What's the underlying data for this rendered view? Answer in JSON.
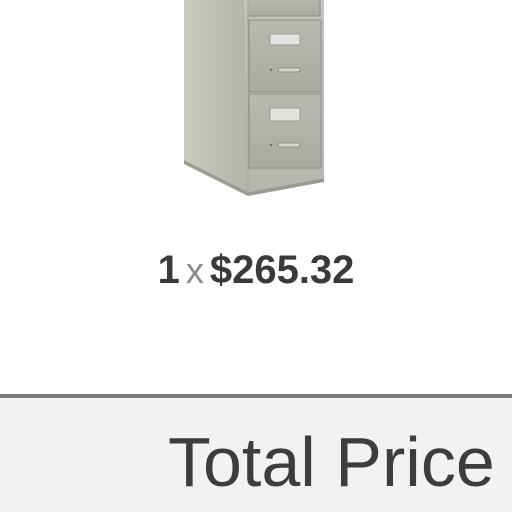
{
  "cart_item": {
    "image_icon": "file-cabinet-icon",
    "quantity": "1",
    "times_symbol": "x",
    "unit_price": "$265.32"
  },
  "summary": {
    "total_label": "Total Price"
  },
  "colors": {
    "cabinet_body": "#bcbeb6",
    "cabinet_dark": "#9fa198",
    "text_dark": "#3a3a3a",
    "times_gray": "#8a8a8a",
    "divider": "#7a7a7a",
    "total_bar_bg": "#f2f2f2"
  }
}
